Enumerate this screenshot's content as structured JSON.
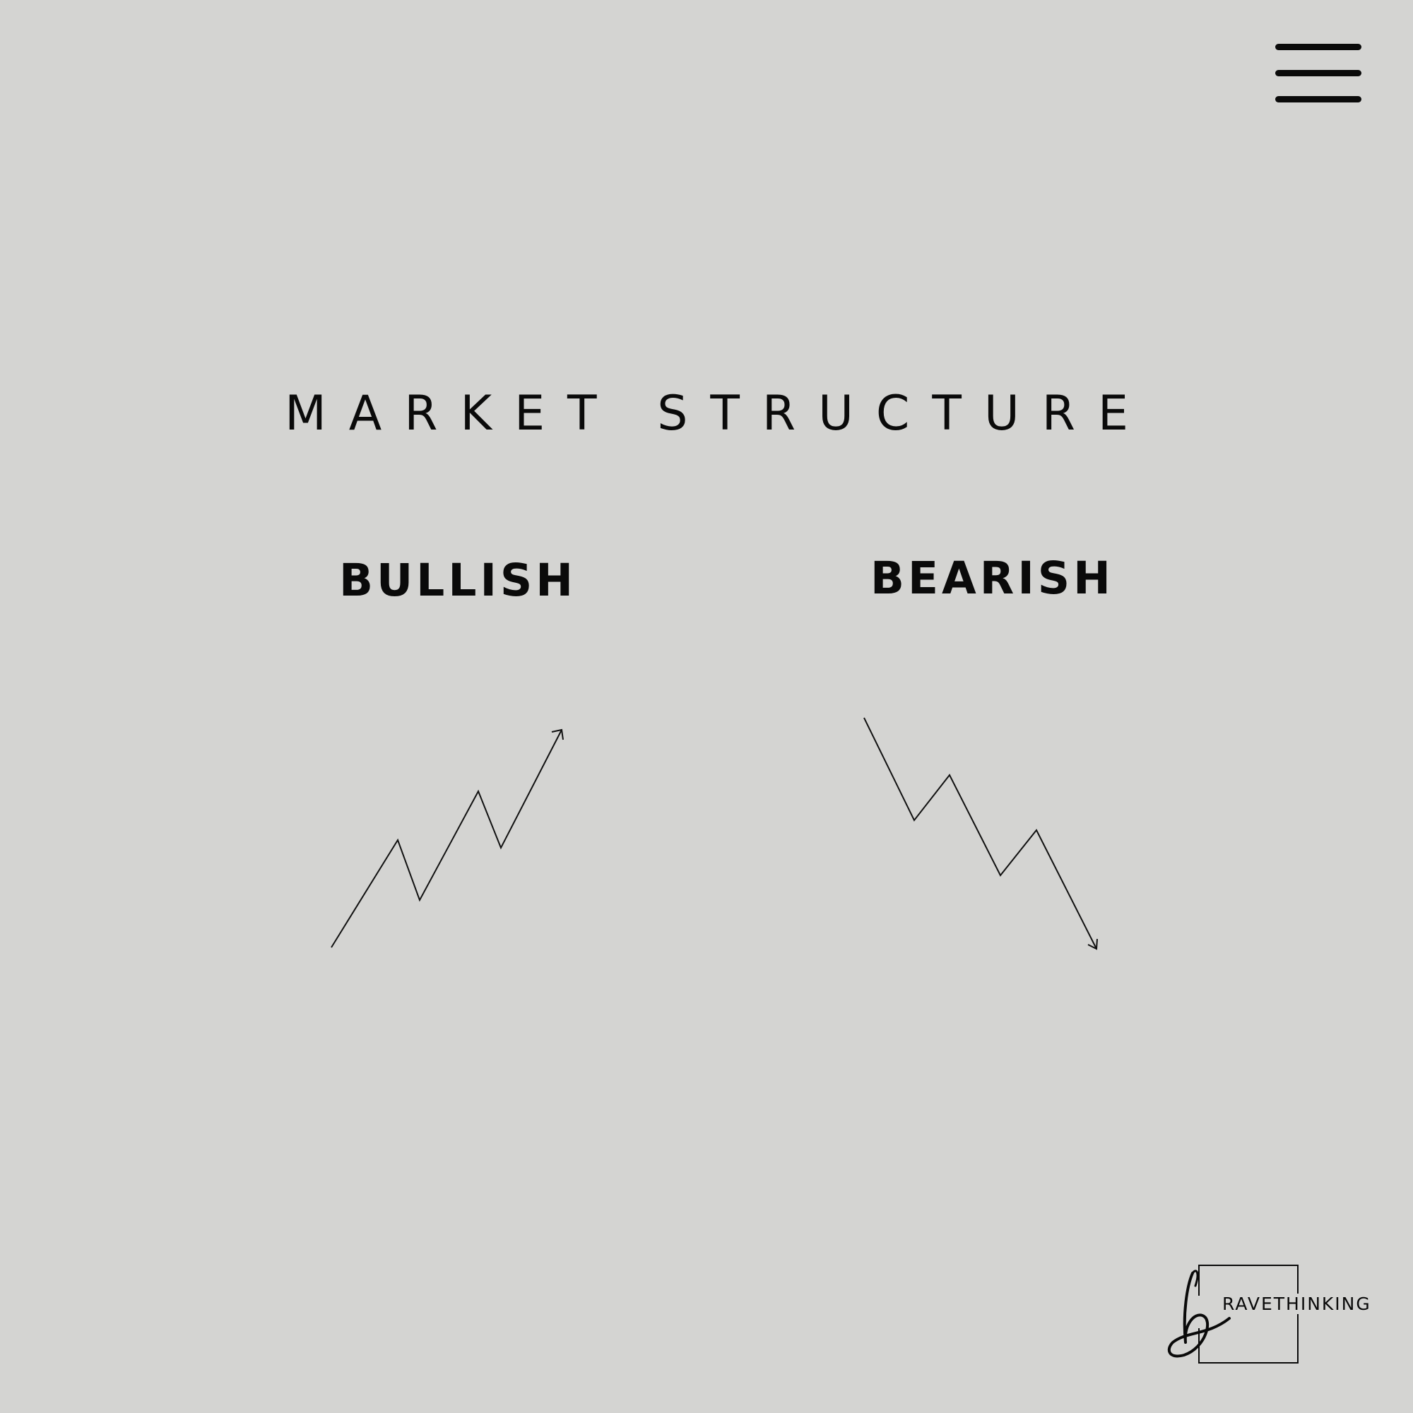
{
  "header": {
    "menu_icon": "hamburger-menu-icon"
  },
  "title": "MARKET STRUCTURE",
  "panels": [
    {
      "label": "BULLISH",
      "direction": "up"
    },
    {
      "label": "BEARISH",
      "direction": "down"
    }
  ],
  "logo": {
    "text": "RAVETHINKING",
    "glyph": "b"
  }
}
